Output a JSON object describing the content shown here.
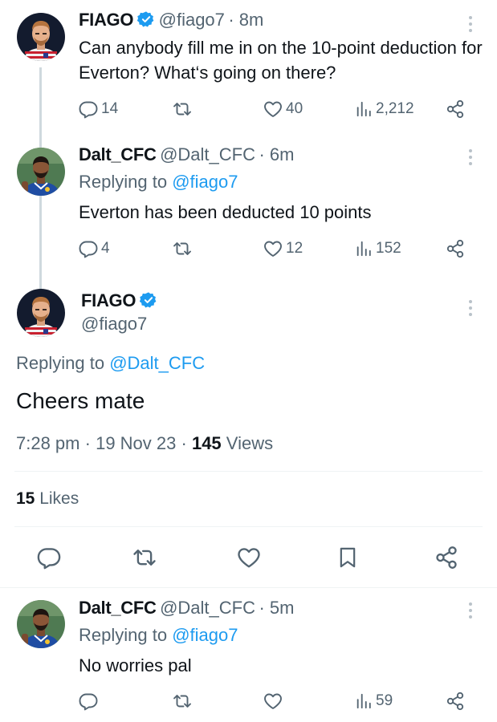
{
  "tweet1": {
    "name": "FIAGO",
    "handle": "@fiago7",
    "time": "· 8m",
    "text": "Can anybody fill me in on the 10-point deduction for Everton? What‘s going on there?",
    "replies": "14",
    "likes": "40",
    "views": "2,212"
  },
  "tweet2": {
    "name": "Dalt_CFC",
    "handle": "@Dalt_CFC",
    "time": "· 6m",
    "replying_prefix": "Replying to",
    "replying_to": "@fiago7",
    "text": "Everton has been deducted 10 points",
    "replies": "4",
    "likes": "12",
    "views": "152"
  },
  "main": {
    "name": "FIAGO",
    "handle": "@fiago7",
    "replying_prefix": "Replying to",
    "replying_to": "@Dalt_CFC",
    "text": "Cheers mate",
    "time": "7:28 pm",
    "date": "19 Nov 23",
    "views_count": "145",
    "views_label": "Views",
    "likes_count": "15",
    "likes_label": "Likes"
  },
  "tweet3": {
    "name": "Dalt_CFC",
    "handle": "@Dalt_CFC",
    "time": "· 5m",
    "replying_prefix": "Replying to",
    "replying_to": "@fiago7",
    "text": "No worries pal",
    "views": "59"
  },
  "colors": {
    "accent": "#1d9bf0",
    "text": "#0f1419",
    "secondary": "#536471"
  },
  "icons": [
    "reply-icon",
    "retweet-icon",
    "like-icon",
    "views-icon",
    "share-icon",
    "bookmark-icon",
    "more-icon",
    "verified-badge-icon"
  ]
}
